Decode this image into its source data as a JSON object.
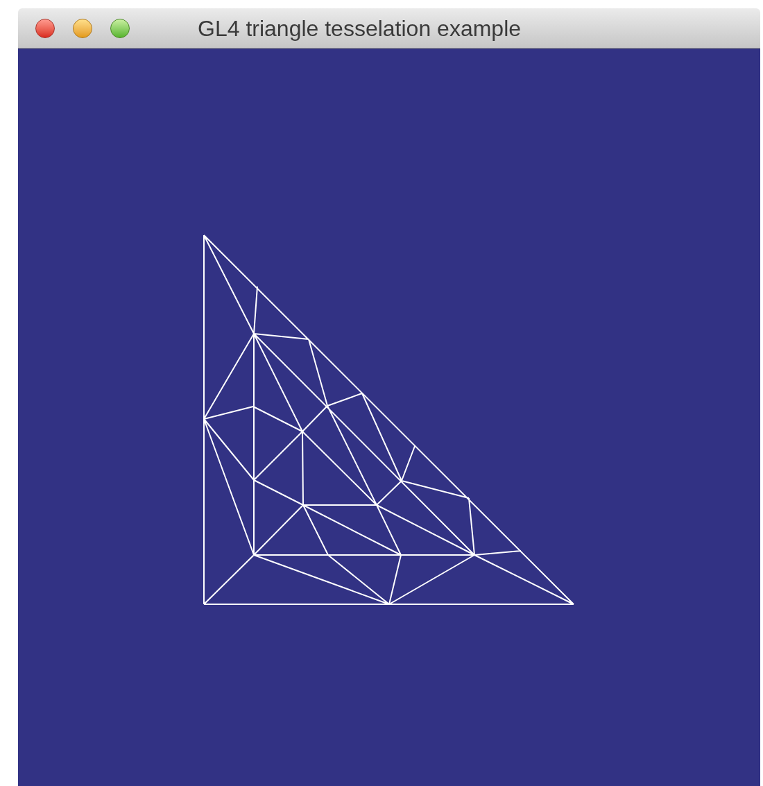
{
  "window": {
    "title": "GL4 triangle tesselation example"
  }
}
